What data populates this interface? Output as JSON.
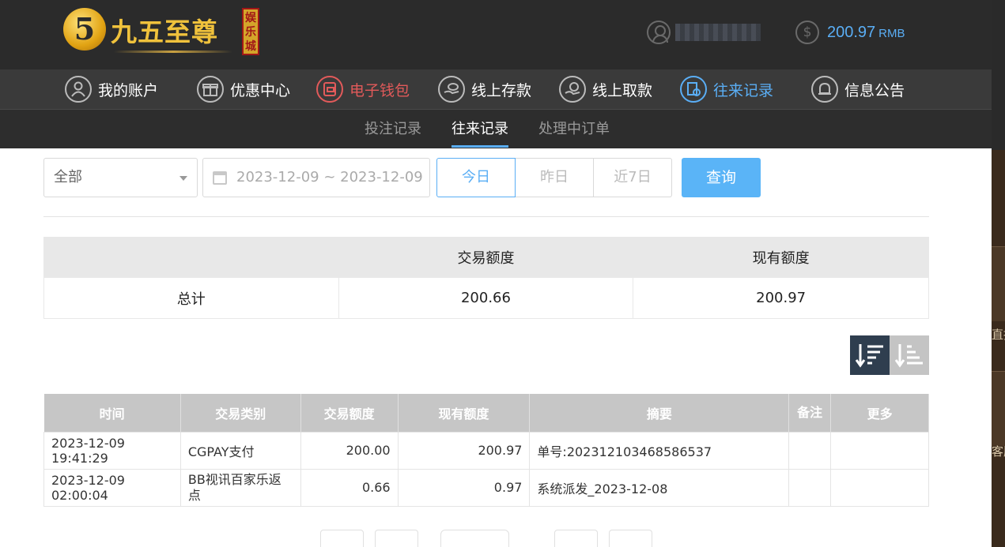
{
  "header": {
    "logo_numeral": "5",
    "logo_text": "九五至尊",
    "logo_badge": "娱乐城",
    "user_name": "",
    "balance": "200.97",
    "balance_unit": "RMB"
  },
  "nav": {
    "items": [
      {
        "label": "我的账户",
        "icon": "user-icon"
      },
      {
        "label": "优惠中心",
        "icon": "gift-icon"
      },
      {
        "label": "电子钱包",
        "icon": "wallet-icon"
      },
      {
        "label": "线上存款",
        "icon": "deposit-icon"
      },
      {
        "label": "线上取款",
        "icon": "withdraw-icon"
      },
      {
        "label": "往来记录",
        "icon": "records-icon"
      },
      {
        "label": "信息公告",
        "icon": "bell-icon"
      }
    ],
    "active": "往来记录",
    "highlight": "电子钱包",
    "colors": {
      "active": "#5aaef5",
      "highlight": "#e25a5a"
    }
  },
  "subnav": {
    "tabs": [
      "投注记录",
      "往来记录",
      "处理中订单"
    ],
    "active": "往来记录"
  },
  "filters": {
    "type_select": "全部",
    "date_range": "2023-12-09 ~ 2023-12-09",
    "quick": [
      "今日",
      "昨日",
      "近7日"
    ],
    "quick_active": "今日",
    "query_label": "查询"
  },
  "summary": {
    "headers": [
      "",
      "交易额度",
      "现有额度"
    ],
    "row_label": "总计",
    "trade_amount": "200.66",
    "current_amount": "200.97"
  },
  "records": {
    "headers": [
      "时间",
      "交易类别",
      "交易额度",
      "现有额度",
      "摘要",
      "备注",
      "更多"
    ],
    "rows": [
      [
        "2023-12-09 19:41:29",
        "CGPAY支付",
        "200.00",
        "200.97",
        "单号:202312103468586537",
        "",
        ""
      ],
      [
        "2023-12-09 02:00:04",
        "BB视讯百家乐返点",
        "0.66",
        "0.97",
        "系统派发_2023-12-08",
        "",
        ""
      ]
    ]
  },
  "right_side": {
    "text1": "直播",
    "text2": "客服"
  }
}
